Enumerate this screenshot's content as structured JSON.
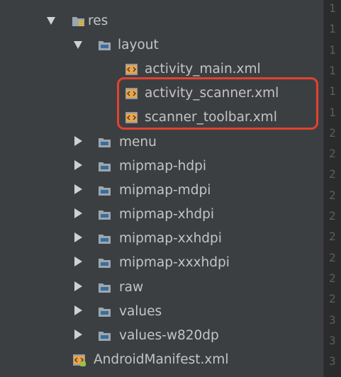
{
  "tree": {
    "res": {
      "label": "res",
      "expanded": true,
      "icon": "resource-folder-icon"
    },
    "layout": {
      "label": "layout",
      "expanded": true,
      "icon": "folder-icon"
    },
    "files": [
      {
        "label": "activity_main.xml",
        "icon": "xml-layout-file-icon"
      },
      {
        "label": "activity_scanner.xml",
        "icon": "xml-layout-file-icon"
      },
      {
        "label": "scanner_toolbar.xml",
        "icon": "xml-layout-file-icon"
      }
    ],
    "folders": [
      {
        "label": "menu",
        "expanded": false
      },
      {
        "label": "mipmap-hdpi",
        "expanded": false
      },
      {
        "label": "mipmap-mdpi",
        "expanded": false
      },
      {
        "label": "mipmap-xhdpi",
        "expanded": false
      },
      {
        "label": "mipmap-xxhdpi",
        "expanded": false
      },
      {
        "label": "mipmap-xxxhdpi",
        "expanded": false
      },
      {
        "label": "raw",
        "expanded": false
      },
      {
        "label": "values",
        "expanded": false
      },
      {
        "label": "values-w820dp",
        "expanded": false
      }
    ],
    "manifest": {
      "label": "AndroidManifest.xml",
      "icon": "android-manifest-icon"
    }
  },
  "gutter": {
    "line_numbers": [
      "1",
      "1",
      "1",
      "1",
      "1",
      "1",
      "2",
      "2",
      "2",
      "2",
      "2",
      "2",
      "2",
      "2",
      "2",
      "3",
      "3",
      "3"
    ]
  },
  "colors": {
    "background": "#3c3f41",
    "text": "#c4c4c4",
    "highlight": "#e24230",
    "folder": "#9aa7b0",
    "folder_inner": "#3c6d9a",
    "xml_icon": "#e8a550"
  }
}
